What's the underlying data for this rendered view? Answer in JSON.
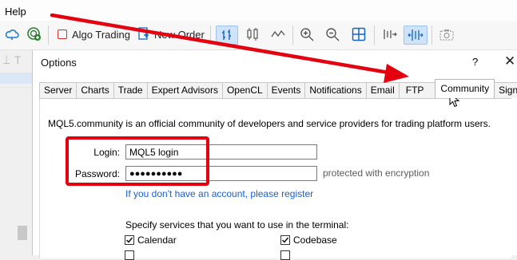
{
  "menubar": {
    "help": "Help"
  },
  "toolbar": {
    "algo_trading": "Algo Trading",
    "new_order": "New Order"
  },
  "dialog": {
    "title": "Options",
    "help": "?",
    "close": "✕",
    "tabs": [
      "Server",
      "Charts",
      "Trade",
      "Expert Advisors",
      "OpenCL",
      "Events",
      "Notifications",
      "Email",
      "FTP",
      "Community",
      "Signals"
    ],
    "description": "MQL5.community is an official community of developers and service providers for trading platform users.",
    "login_label": "Login:",
    "login_value": "MQL5 login",
    "password_label": "Password:",
    "password_value": "●●●●●●●●●●",
    "password_hint": "protected with encryption",
    "register_link": "If you don't have an account, please register",
    "services_heading": "Specify services that you want to use in the terminal:",
    "services": [
      {
        "label": "Calendar",
        "checked": true
      },
      {
        "label": "Codebase",
        "checked": true
      }
    ]
  },
  "colors": {
    "annotation_red": "#e3000f",
    "link_blue": "#1a5fd6",
    "selected_button": "#cfe3fb"
  }
}
